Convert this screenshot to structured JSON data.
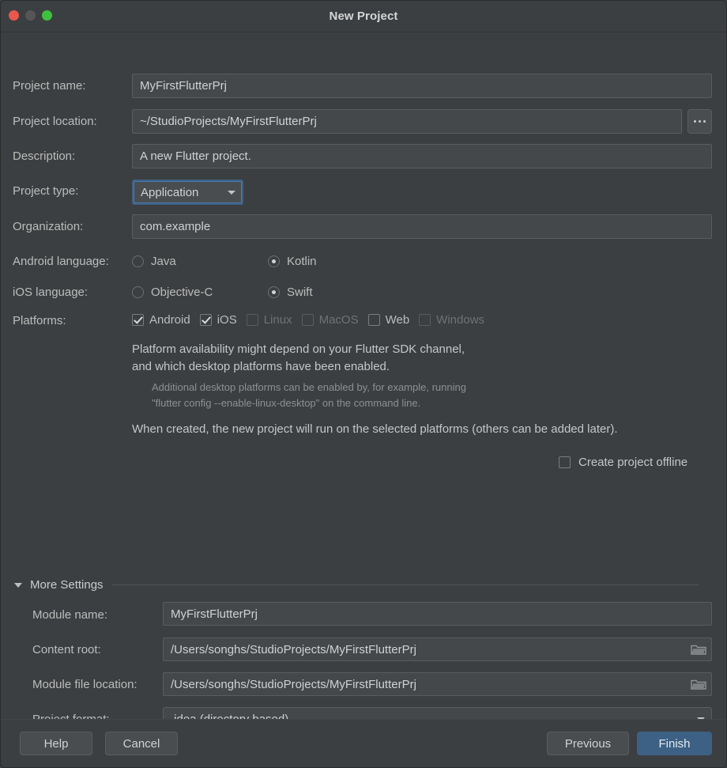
{
  "window": {
    "title": "New Project",
    "controls": {
      "close": "close-button",
      "minimize": "minimize-button",
      "maximize": "maximize-button"
    },
    "accent_color": "#3d6185",
    "background_color": "#3c3f41",
    "field_background": "#45484a"
  },
  "form": {
    "project_name": {
      "label": "Project name:",
      "value": "MyFirstFlutterPrj"
    },
    "project_location": {
      "label": "Project location:",
      "value": "~/StudioProjects/MyFirstFlutterPrj",
      "browse_label": "..."
    },
    "description": {
      "label": "Description:",
      "value": "A new Flutter project."
    },
    "project_type": {
      "label": "Project type:",
      "value": "Application",
      "focused": true
    },
    "organization": {
      "label": "Organization:",
      "value": "com.example"
    },
    "android_language": {
      "label": "Android language:",
      "options": [
        {
          "label": "Java",
          "selected": false
        },
        {
          "label": "Kotlin",
          "selected": true
        }
      ]
    },
    "ios_language": {
      "label": "iOS language:",
      "options": [
        {
          "label": "Objective-C",
          "selected": false
        },
        {
          "label": "Swift",
          "selected": true
        }
      ]
    },
    "platforms": {
      "label": "Platforms:",
      "options": [
        {
          "label": "Android",
          "checked": true,
          "enabled": true
        },
        {
          "label": "iOS",
          "checked": true,
          "enabled": true
        },
        {
          "label": "Linux",
          "checked": false,
          "enabled": false
        },
        {
          "label": "MacOS",
          "checked": false,
          "enabled": false
        },
        {
          "label": "Web",
          "checked": false,
          "enabled": true
        },
        {
          "label": "Windows",
          "checked": false,
          "enabled": false
        }
      ]
    },
    "notes": {
      "availability": "Platform availability might depend on your Flutter SDK channel,\nand which desktop platforms have been enabled.",
      "hint": "Additional desktop platforms can be enabled by, for example, running\n\"flutter config --enable-linux-desktop\" on the command line.",
      "when_created": "When created, the new project will run on the selected platforms (others can be added later)."
    },
    "create_offline": {
      "label": "Create project offline",
      "checked": false
    }
  },
  "more_settings": {
    "title": "More Settings",
    "expanded": true,
    "module_name": {
      "label": "Module name:",
      "value": "MyFirstFlutterPrj"
    },
    "content_root": {
      "label": "Content root:",
      "value": "/Users/songhs/StudioProjects/MyFirstFlutterPrj"
    },
    "module_file_location": {
      "label": "Module file location:",
      "value": "/Users/songhs/StudioProjects/MyFirstFlutterPrj"
    },
    "project_format": {
      "label": "Project format:",
      "value": ".idea (directory based)"
    }
  },
  "footer": {
    "help": "Help",
    "cancel": "Cancel",
    "previous": "Previous",
    "finish": "Finish"
  }
}
